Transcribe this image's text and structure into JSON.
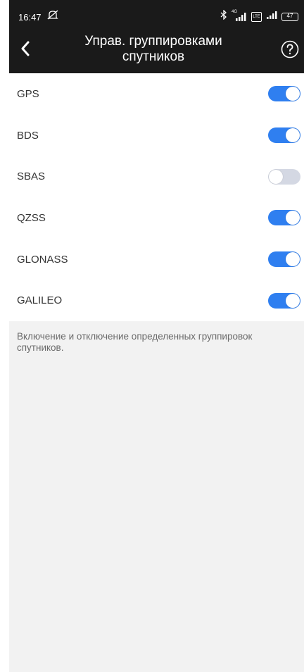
{
  "status_bar": {
    "time": "16:47",
    "battery": "47",
    "network_badge": "4G",
    "lte_badge": "LTE",
    "icons": [
      "mute-icon",
      "bluetooth-icon",
      "signal-icon",
      "lte-icon",
      "signal-icon",
      "battery-icon"
    ]
  },
  "header": {
    "title": "Управ. группировками спутников",
    "back_icon": "chevron-left-icon",
    "help_icon": "question-circle-icon"
  },
  "constellations": [
    {
      "label": "GPS",
      "enabled": true
    },
    {
      "label": "BDS",
      "enabled": true
    },
    {
      "label": "SBAS",
      "enabled": false
    },
    {
      "label": "QZSS",
      "enabled": true
    },
    {
      "label": "GLONASS",
      "enabled": true
    },
    {
      "label": "GALILEO",
      "enabled": true
    }
  ],
  "note": "Включение и отключение определенных группировок спутников.",
  "colors": {
    "header_bg": "#1a1a1a",
    "page_bg": "#f2f2f2",
    "toggle_on": "#2f7ff0",
    "toggle_off": "#d4d8e3"
  }
}
